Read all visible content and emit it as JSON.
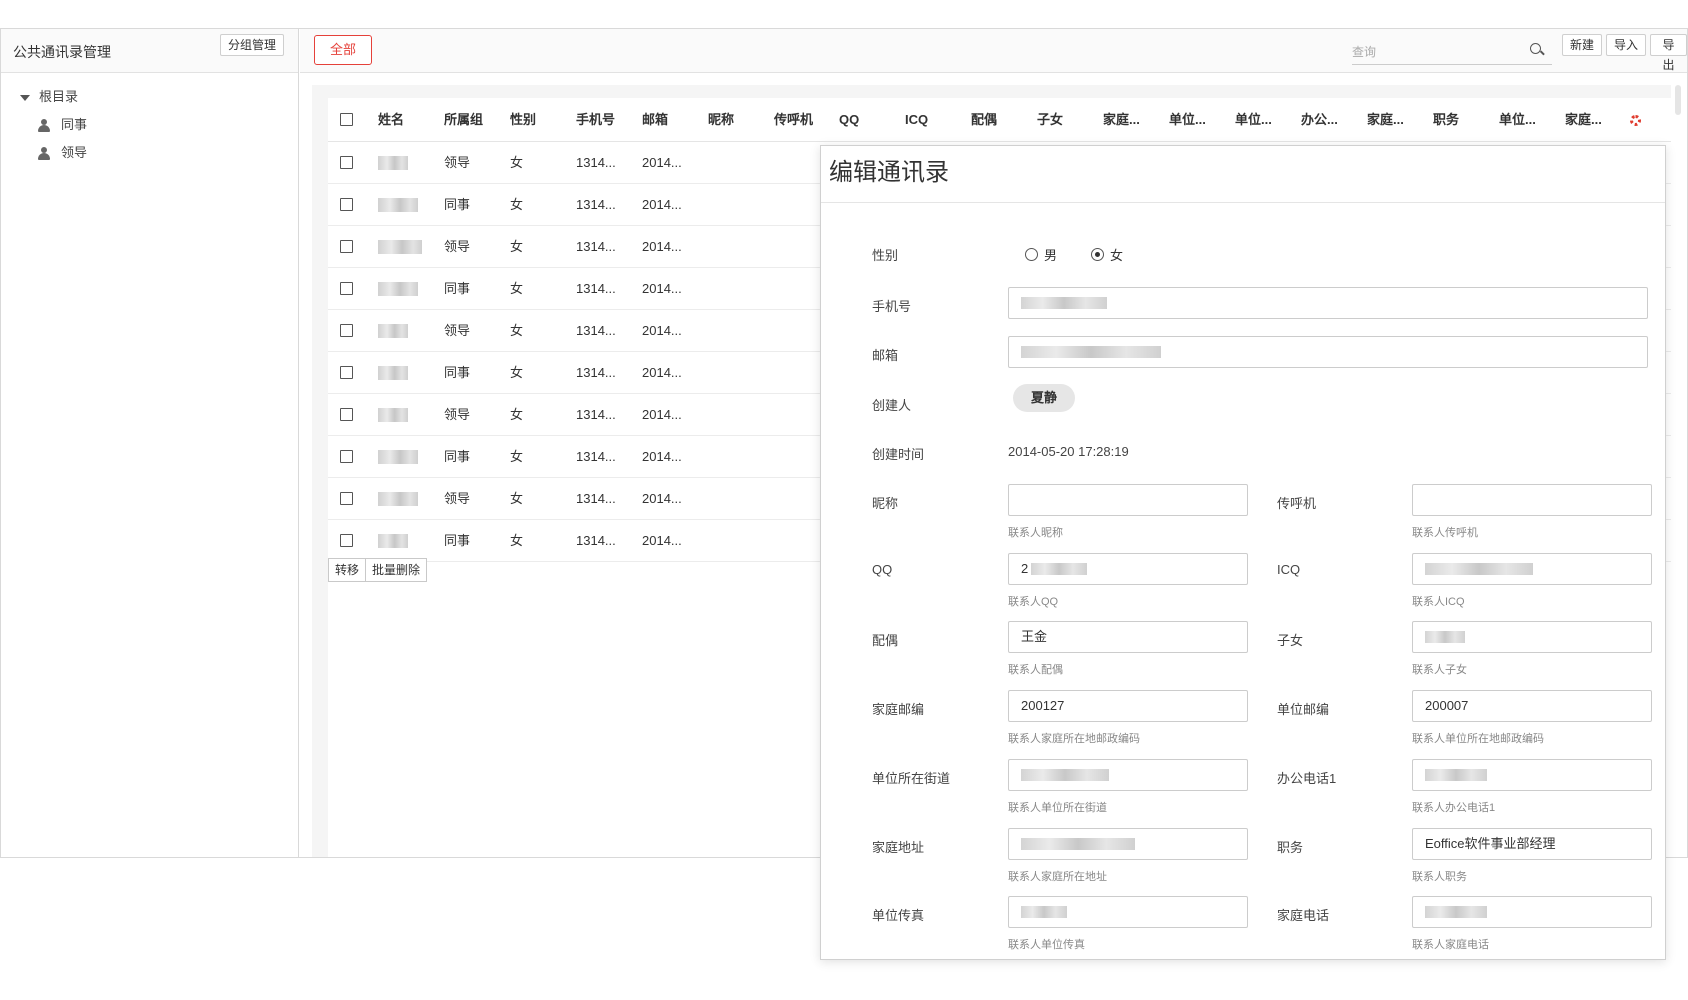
{
  "sidebar": {
    "title": "公共通讯录管理",
    "group_manage": "分组管理",
    "tree": {
      "root": "根目录",
      "items": [
        {
          "label": "同事"
        },
        {
          "label": "领导"
        }
      ]
    }
  },
  "toolbar": {
    "all_label": "全部",
    "search_placeholder": "查询",
    "new_label": "新建",
    "import_label": "导入",
    "export_label": "导出"
  },
  "table": {
    "columns": [
      "姓名",
      "所属组",
      "性别",
      "手机号",
      "邮箱",
      "昵称",
      "传呼机",
      "QQ",
      "ICQ",
      "配偶",
      "子女",
      "家庭...",
      "单位...",
      "单位...",
      "办公...",
      "家庭...",
      "职务",
      "单位...",
      "家庭..."
    ],
    "rows": [
      {
        "group": "领导",
        "gender": "女",
        "mobile": "1314...",
        "email": "2014..."
      },
      {
        "group": "同事",
        "gender": "女",
        "mobile": "1314...",
        "email": "2014..."
      },
      {
        "group": "领导",
        "gender": "女",
        "mobile": "1314...",
        "email": "2014..."
      },
      {
        "group": "同事",
        "gender": "女",
        "mobile": "1314...",
        "email": "2014..."
      },
      {
        "group": "领导",
        "gender": "女",
        "mobile": "1314...",
        "email": "2014..."
      },
      {
        "group": "同事",
        "gender": "女",
        "mobile": "1314...",
        "email": "2014..."
      },
      {
        "group": "领导",
        "gender": "女",
        "mobile": "1314...",
        "email": "2014..."
      },
      {
        "group": "同事",
        "gender": "女",
        "mobile": "1314...",
        "email": "2014..."
      },
      {
        "group": "领导",
        "gender": "女",
        "mobile": "1314...",
        "email": "2014..."
      },
      {
        "group": "同事",
        "gender": "女",
        "mobile": "1314...",
        "email": "2014..."
      }
    ],
    "transfer_label": "转移",
    "bulk_delete_label": "批量删除"
  },
  "modal": {
    "title": "编辑通讯录",
    "gender": {
      "label": "性别",
      "male": "男",
      "female": "女",
      "selected": "female"
    },
    "mobile": {
      "label": "手机号"
    },
    "email": {
      "label": "邮箱"
    },
    "creator": {
      "label": "创建人",
      "value": "夏静"
    },
    "created_time": {
      "label": "创建时间",
      "value": "2014-05-20 17:28:19"
    },
    "nickname": {
      "label": "昵称",
      "value": "",
      "hint": "联系人昵称"
    },
    "pager": {
      "label": "传呼机",
      "value": "",
      "hint": "联系人传呼机"
    },
    "qq": {
      "label": "QQ",
      "value": "2",
      "hint": "联系人QQ"
    },
    "icq": {
      "label": "ICQ",
      "hint": "联系人ICQ"
    },
    "spouse": {
      "label": "配偶",
      "value": "王金",
      "hint": "联系人配偶"
    },
    "children": {
      "label": "子女",
      "hint": "联系人子女"
    },
    "home_zip": {
      "label": "家庭邮编",
      "value": "200127",
      "hint": "联系人家庭所在地邮政编码"
    },
    "work_zip": {
      "label": "单位邮编",
      "value": "200007",
      "hint": "联系人单位所在地邮政编码"
    },
    "work_street": {
      "label": "单位所在街道",
      "hint": "联系人单位所在街道"
    },
    "office_phone": {
      "label": "办公电话1",
      "hint": "联系人办公电话1"
    },
    "home_address": {
      "label": "家庭地址",
      "hint": "联系人家庭所在地址"
    },
    "position": {
      "label": "职务",
      "value": "Eoffice软件事业部经理",
      "hint": "联系人职务"
    },
    "work_fax": {
      "label": "单位传真",
      "hint": "联系人单位传真"
    },
    "home_phone": {
      "label": "家庭电话",
      "hint": "联系人家庭电话"
    }
  },
  "colors": {
    "accent": "#e5413a",
    "gear": "#e03c2f"
  }
}
